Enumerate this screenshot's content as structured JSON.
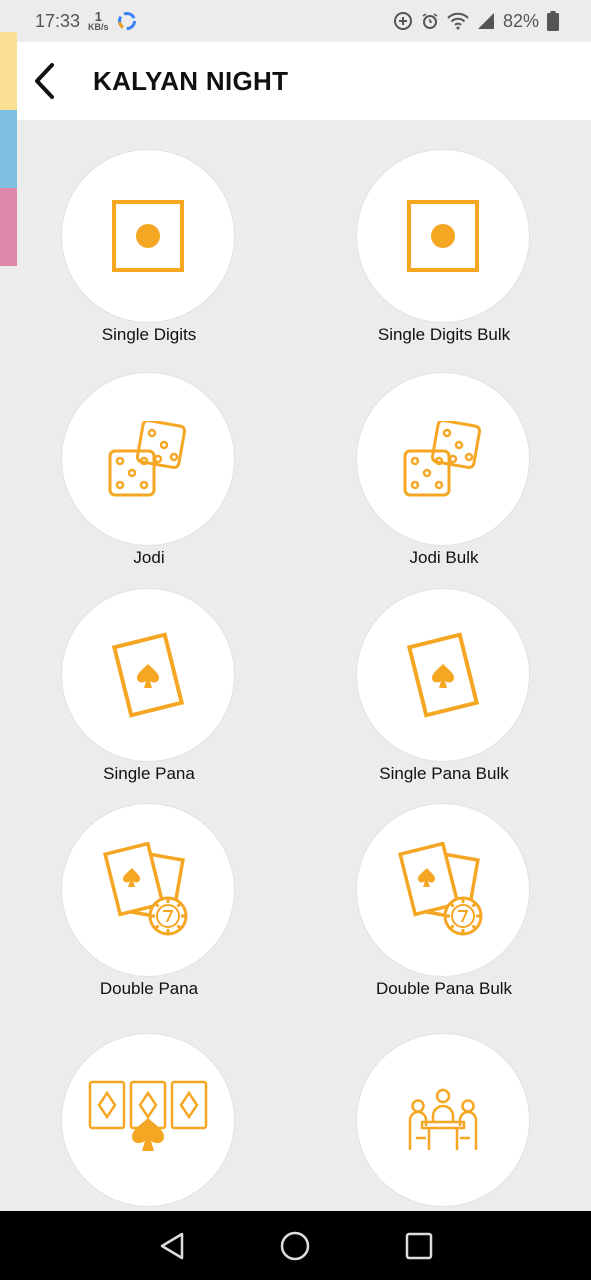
{
  "status_bar": {
    "time": "17:33",
    "net_speed_value": "1",
    "net_speed_unit": "KB/s",
    "battery": "82%"
  },
  "side_strip_colors": [
    "#fbdf95",
    "#7ec0e2",
    "#df87ab"
  ],
  "header": {
    "title": "KALYAN NIGHT"
  },
  "accent_color": "#f5a623",
  "games": [
    {
      "label": "Single Digits",
      "icon": "single-digit-icon"
    },
    {
      "label": "Single Digits Bulk",
      "icon": "single-digit-icon"
    },
    {
      "label": "Jodi",
      "icon": "dice-icon"
    },
    {
      "label": "Jodi Bulk",
      "icon": "dice-icon"
    },
    {
      "label": "Single Pana",
      "icon": "card-icon"
    },
    {
      "label": "Single Pana Bulk",
      "icon": "card-icon"
    },
    {
      "label": "Double Pana",
      "icon": "cards-chip-icon"
    },
    {
      "label": "Double Pana Bulk",
      "icon": "cards-chip-icon"
    },
    {
      "label": "",
      "icon": "triple-cards-icon"
    },
    {
      "label": "",
      "icon": "meeting-icon"
    }
  ]
}
